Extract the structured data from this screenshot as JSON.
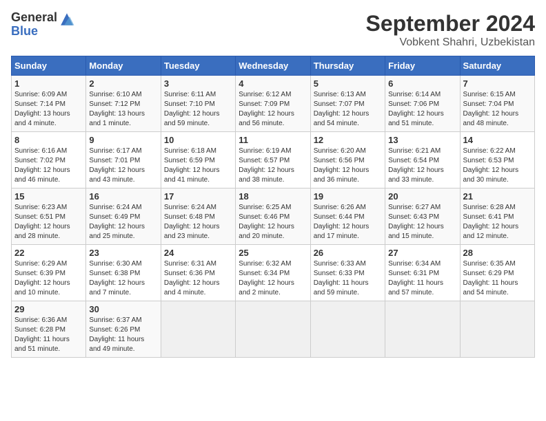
{
  "logo": {
    "line1": "General",
    "line2": "Blue"
  },
  "title": "September 2024",
  "subtitle": "Vobkent Shahri, Uzbekistan",
  "weekdays": [
    "Sunday",
    "Monday",
    "Tuesday",
    "Wednesday",
    "Thursday",
    "Friday",
    "Saturday"
  ],
  "weeks": [
    [
      {
        "day": "1",
        "sunrise": "6:09 AM",
        "sunset": "7:14 PM",
        "daylight": "13 hours and 4 minutes."
      },
      {
        "day": "2",
        "sunrise": "6:10 AM",
        "sunset": "7:12 PM",
        "daylight": "13 hours and 1 minute."
      },
      {
        "day": "3",
        "sunrise": "6:11 AM",
        "sunset": "7:10 PM",
        "daylight": "12 hours and 59 minutes."
      },
      {
        "day": "4",
        "sunrise": "6:12 AM",
        "sunset": "7:09 PM",
        "daylight": "12 hours and 56 minutes."
      },
      {
        "day": "5",
        "sunrise": "6:13 AM",
        "sunset": "7:07 PM",
        "daylight": "12 hours and 54 minutes."
      },
      {
        "day": "6",
        "sunrise": "6:14 AM",
        "sunset": "7:06 PM",
        "daylight": "12 hours and 51 minutes."
      },
      {
        "day": "7",
        "sunrise": "6:15 AM",
        "sunset": "7:04 PM",
        "daylight": "12 hours and 48 minutes."
      }
    ],
    [
      {
        "day": "8",
        "sunrise": "6:16 AM",
        "sunset": "7:02 PM",
        "daylight": "12 hours and 46 minutes."
      },
      {
        "day": "9",
        "sunrise": "6:17 AM",
        "sunset": "7:01 PM",
        "daylight": "12 hours and 43 minutes."
      },
      {
        "day": "10",
        "sunrise": "6:18 AM",
        "sunset": "6:59 PM",
        "daylight": "12 hours and 41 minutes."
      },
      {
        "day": "11",
        "sunrise": "6:19 AM",
        "sunset": "6:57 PM",
        "daylight": "12 hours and 38 minutes."
      },
      {
        "day": "12",
        "sunrise": "6:20 AM",
        "sunset": "6:56 PM",
        "daylight": "12 hours and 36 minutes."
      },
      {
        "day": "13",
        "sunrise": "6:21 AM",
        "sunset": "6:54 PM",
        "daylight": "12 hours and 33 minutes."
      },
      {
        "day": "14",
        "sunrise": "6:22 AM",
        "sunset": "6:53 PM",
        "daylight": "12 hours and 30 minutes."
      }
    ],
    [
      {
        "day": "15",
        "sunrise": "6:23 AM",
        "sunset": "6:51 PM",
        "daylight": "12 hours and 28 minutes."
      },
      {
        "day": "16",
        "sunrise": "6:24 AM",
        "sunset": "6:49 PM",
        "daylight": "12 hours and 25 minutes."
      },
      {
        "day": "17",
        "sunrise": "6:24 AM",
        "sunset": "6:48 PM",
        "daylight": "12 hours and 23 minutes."
      },
      {
        "day": "18",
        "sunrise": "6:25 AM",
        "sunset": "6:46 PM",
        "daylight": "12 hours and 20 minutes."
      },
      {
        "day": "19",
        "sunrise": "6:26 AM",
        "sunset": "6:44 PM",
        "daylight": "12 hours and 17 minutes."
      },
      {
        "day": "20",
        "sunrise": "6:27 AM",
        "sunset": "6:43 PM",
        "daylight": "12 hours and 15 minutes."
      },
      {
        "day": "21",
        "sunrise": "6:28 AM",
        "sunset": "6:41 PM",
        "daylight": "12 hours and 12 minutes."
      }
    ],
    [
      {
        "day": "22",
        "sunrise": "6:29 AM",
        "sunset": "6:39 PM",
        "daylight": "12 hours and 10 minutes."
      },
      {
        "day": "23",
        "sunrise": "6:30 AM",
        "sunset": "6:38 PM",
        "daylight": "12 hours and 7 minutes."
      },
      {
        "day": "24",
        "sunrise": "6:31 AM",
        "sunset": "6:36 PM",
        "daylight": "12 hours and 4 minutes."
      },
      {
        "day": "25",
        "sunrise": "6:32 AM",
        "sunset": "6:34 PM",
        "daylight": "12 hours and 2 minutes."
      },
      {
        "day": "26",
        "sunrise": "6:33 AM",
        "sunset": "6:33 PM",
        "daylight": "11 hours and 59 minutes."
      },
      {
        "day": "27",
        "sunrise": "6:34 AM",
        "sunset": "6:31 PM",
        "daylight": "11 hours and 57 minutes."
      },
      {
        "day": "28",
        "sunrise": "6:35 AM",
        "sunset": "6:29 PM",
        "daylight": "11 hours and 54 minutes."
      }
    ],
    [
      {
        "day": "29",
        "sunrise": "6:36 AM",
        "sunset": "6:28 PM",
        "daylight": "11 hours and 51 minutes."
      },
      {
        "day": "30",
        "sunrise": "6:37 AM",
        "sunset": "6:26 PM",
        "daylight": "11 hours and 49 minutes."
      },
      null,
      null,
      null,
      null,
      null
    ]
  ],
  "labels": {
    "sunrise": "Sunrise:",
    "sunset": "Sunset:",
    "daylight": "Daylight:"
  }
}
